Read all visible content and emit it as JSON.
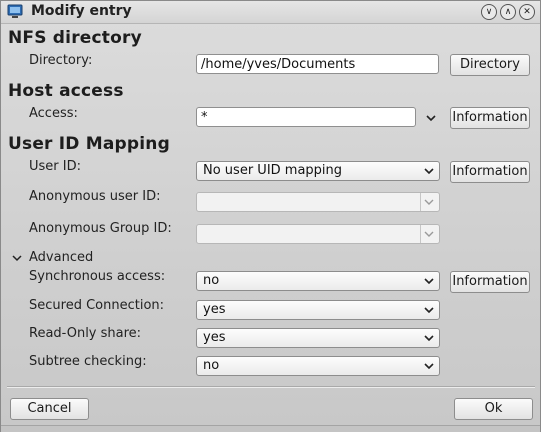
{
  "window": {
    "title": "Modify entry"
  },
  "nfs": {
    "heading": "NFS directory",
    "directory_label": "Directory:",
    "directory_value": "/home/yves/Documents",
    "directory_button": "Directory"
  },
  "host": {
    "heading": "Host access",
    "access_label": "Access:",
    "access_value": "*",
    "info_button": "Information"
  },
  "uid": {
    "heading": "User ID Mapping",
    "user_id_label": "User ID:",
    "user_id_value": "No user UID mapping",
    "info_button": "Information",
    "anon_user_label": "Anonymous user ID:",
    "anon_group_label": "Anonymous Group ID:"
  },
  "advanced": {
    "toggle_label": "Advanced",
    "sync_label": "Synchronous access:",
    "sync_value": "no",
    "info_button": "Information",
    "secured_label": "Secured Connection:",
    "secured_value": "yes",
    "readonly_label": "Read-Only share:",
    "readonly_value": "yes",
    "subtree_label": "Subtree checking:",
    "subtree_value": "no"
  },
  "footer": {
    "cancel_label": "Cancel",
    "ok_label": "Ok"
  }
}
